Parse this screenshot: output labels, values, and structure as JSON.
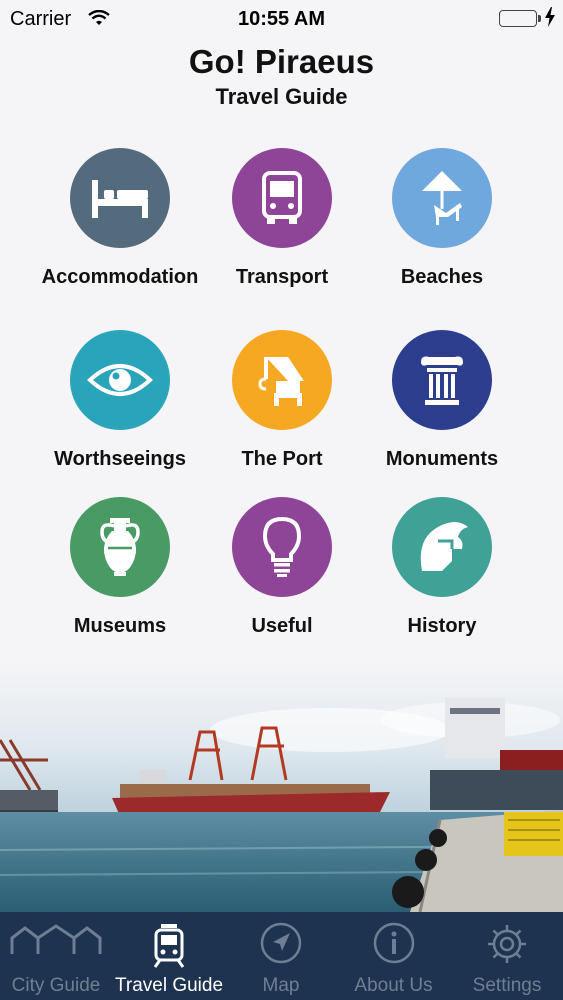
{
  "status_bar": {
    "carrier": "Carrier",
    "time": "10:55 AM",
    "battery_color": "#4cd964"
  },
  "header": {
    "title": "Go! Piraeus",
    "subtitle": "Travel Guide"
  },
  "grid": [
    {
      "label": "Accommodation",
      "icon": "bed-icon",
      "color": "#546b7e"
    },
    {
      "label": "Transport",
      "icon": "bus-icon",
      "color": "#8e4597"
    },
    {
      "label": "Beaches",
      "icon": "beach-umbrella-icon",
      "color": "#6fa8dc"
    },
    {
      "label": "Worthseeings",
      "icon": "eye-icon",
      "color": "#2aa4b8"
    },
    {
      "label": "The Port",
      "icon": "crane-icon",
      "color": "#f7a823"
    },
    {
      "label": "Monuments",
      "icon": "column-icon",
      "color": "#2e3e8e"
    },
    {
      "label": "Museums",
      "icon": "amphora-icon",
      "color": "#4a9a64"
    },
    {
      "label": "Useful",
      "icon": "lightbulb-icon",
      "color": "#8e4597"
    },
    {
      "label": "History",
      "icon": "spartan-helmet-icon",
      "color": "#40a196"
    }
  ],
  "tab_bar": {
    "active_tab": "Travel Guide",
    "tabs": [
      {
        "label": "City Guide",
        "icon": "city-icon"
      },
      {
        "label": "Travel Guide",
        "icon": "tram-icon"
      },
      {
        "label": "Map",
        "icon": "navigation-arrow-icon"
      },
      {
        "label": "About Us",
        "icon": "info-icon"
      },
      {
        "label": "Settings",
        "icon": "gear-icon"
      }
    ]
  }
}
